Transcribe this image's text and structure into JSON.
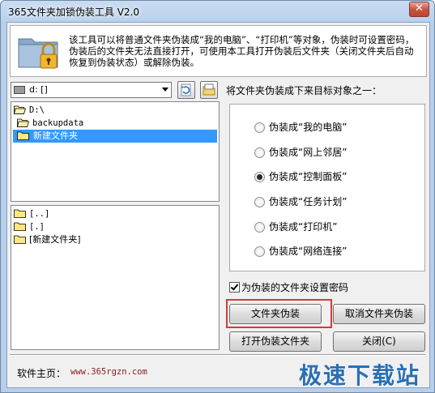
{
  "window": {
    "title": "365文件夹加锁伪装工具 V2.0",
    "close_glyph": "✕"
  },
  "header": {
    "description": "该工具可以将普通文件夹伪装成“我的电脑”、“打印机”等对象，伪装时可设置密码，伪装后的文件夹无法直接打开，可使用本工具打开伪装后文件夹（关闭文件夹后自动恢复到伪装状态）或解除伪装。",
    "icon": "folder-lock-icon"
  },
  "drive_select": {
    "value": "d:  []",
    "icon": "drive-icon"
  },
  "toolbar": {
    "refresh_icon": "refresh-icon",
    "new_folder_icon": "new-folder-icon"
  },
  "folder_tree": {
    "items": [
      {
        "label": "D:\\",
        "icon": "open-folder-icon",
        "indent": 0
      },
      {
        "label": "backupdata",
        "icon": "open-folder-icon",
        "indent": 1
      },
      {
        "label": "新建文件夹",
        "icon": "folder-icon",
        "indent": 2,
        "selected": true
      }
    ]
  },
  "file_list": {
    "items": [
      {
        "label": "[..]",
        "icon": "folder-icon"
      },
      {
        "label": "[.]",
        "icon": "folder-icon"
      },
      {
        "label": "[新建文件夹]",
        "icon": "folder-icon"
      }
    ]
  },
  "targets": {
    "heading": "将文件夹伪装成下来目标对象之一：",
    "options": [
      {
        "label": "伪装成“我的电脑”",
        "checked": false
      },
      {
        "label": "伪装成“网上邻居”",
        "checked": false
      },
      {
        "label": "伪装成“控制面板”",
        "checked": true
      },
      {
        "label": "伪装成“任务计划”",
        "checked": false
      },
      {
        "label": "伪装成“打印机”",
        "checked": false
      },
      {
        "label": "伪装成“网络连接”",
        "checked": false
      }
    ]
  },
  "password": {
    "label": "为伪装的文件夹设置密码",
    "checked": true
  },
  "buttons": {
    "disguise": "文件夹伪装",
    "cancel_disguise": "取消文件夹伪装",
    "open_disguised": "打开伪装文件夹",
    "close": "关闭(C)"
  },
  "footer": {
    "home_label": "软件主页：",
    "url": "www.365rgzn.com",
    "watermark": "极速下载站"
  },
  "colors": {
    "selection": "#3399ff",
    "highlight_box": "#d63a3a",
    "url_text": "#8b1a1a",
    "watermark": "#2a6fb5"
  }
}
